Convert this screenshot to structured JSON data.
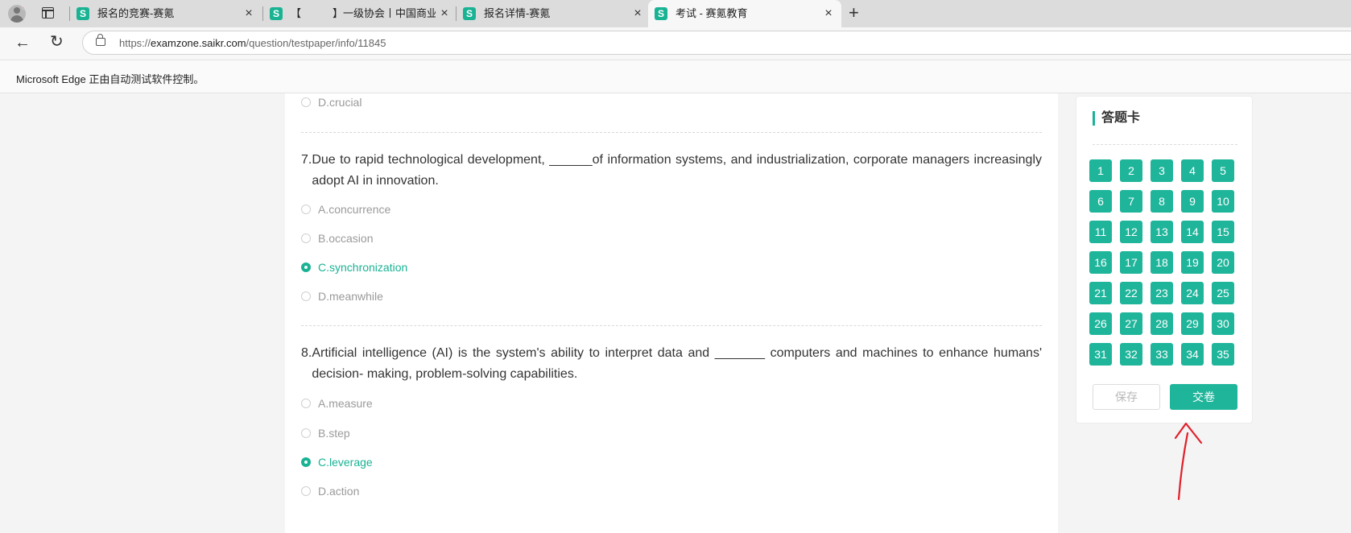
{
  "tabs": [
    {
      "title": "报名的竞赛-赛氪",
      "active": false
    },
    {
      "title": "【　　　】一级协会丨中国商业联",
      "active": false
    },
    {
      "title": "报名详情-赛氪",
      "active": false
    },
    {
      "title": "考试 - 赛氪教育",
      "active": true
    }
  ],
  "favicon_letter": "S",
  "address": {
    "prefix": "https://",
    "host": "examzone.saikr.com",
    "path": "/question/testpaper/info/11845"
  },
  "infobar": {
    "text": "Microsoft Edge 正由自动测试软件控制。"
  },
  "questions": {
    "prev_option": "D.crucial",
    "q7": {
      "number": "7.",
      "text": "Due to rapid technological development, ______of  information systems, and industrialization, corporate managers increasingly adopt AI in innovation.",
      "options": [
        "A.concurrence",
        "B.occasion",
        "C.synchronization",
        "D.meanwhile"
      ],
      "selected": 2
    },
    "q8": {
      "number": "8.",
      "text": "Artificial intelligence (AI) is the system's ability to interpret data and  _______  computers and machines to enhance humans' decision- making, problem-solving capabilities.",
      "options": [
        "A.measure",
        "B.step",
        "C.leverage",
        "D.action"
      ],
      "selected": 2
    }
  },
  "answer_card": {
    "title": "答题卡",
    "numbers": [
      "1",
      "2",
      "3",
      "4",
      "5",
      "6",
      "7",
      "8",
      "9",
      "10",
      "11",
      "12",
      "13",
      "14",
      "15",
      "16",
      "17",
      "18",
      "19",
      "20",
      "21",
      "22",
      "23",
      "24",
      "25",
      "26",
      "27",
      "28",
      "29",
      "30",
      "31",
      "32",
      "33",
      "34",
      "35"
    ],
    "save_label": "保存",
    "submit_label": "交卷"
  },
  "colors": {
    "accent": "#1fb59b",
    "annotation_arrow": "#e0202a"
  }
}
